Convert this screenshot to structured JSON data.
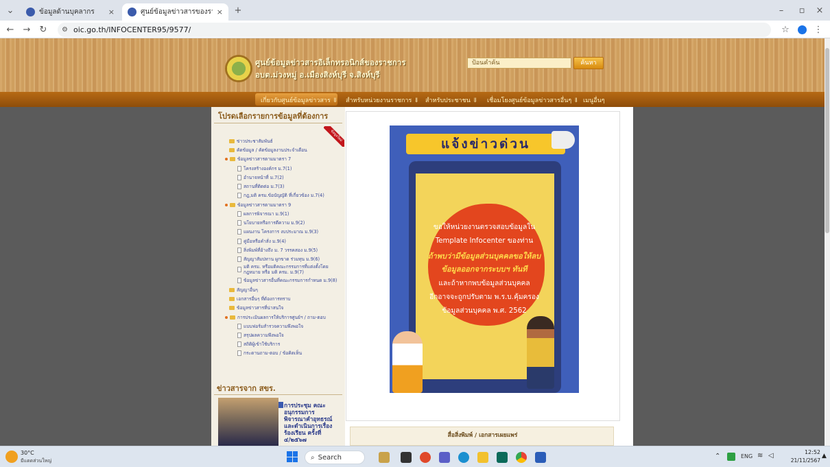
{
  "browser": {
    "tabs": [
      {
        "title": "ข้อมูลด้านบุคลากร"
      },
      {
        "title": "ศูนย์ข้อมูลข่าวสารของราชการ » อบ"
      }
    ],
    "new_tab_label": "+",
    "url": "oic.go.th/INFOCENTER95/9577/"
  },
  "site": {
    "title_line1": "ศูนย์ข้อมูลข่าวสารอิเล็กทรอนิกส์ของราชการ",
    "title_line2": "อบต.ม่วงหมู่ อ.เมืองสิงห์บุรี จ.สิงห์บุรี",
    "search_placeholder": "ป้อนคำค้น",
    "search_button": "ค้นหา",
    "nav": [
      "เกี่ยวกับศูนย์ข้อมูลข่าวสาร ⇓",
      "สำหรับหน่วยงานราชการ ⇓",
      "สำหรับประชาชน ⇓",
      "เชื่อมโยงศูนย์ข้อมูลข่าวสารอื่นๆ ⇓",
      "เมนูอื่นๆ"
    ]
  },
  "sidebar": {
    "title": "โปรดเลือกรายการข้อมูลที่ต้องการ",
    "ribbon": "ข้อมูลใหม่",
    "items": [
      {
        "label": "ข่าวประชาสัมพันธ์",
        "level": 0
      },
      {
        "label": "คัดข้อมูล / คัดข้อมูลงานประจำเดือน",
        "level": 0
      },
      {
        "label": "ข้อมูลข่าวสารตามมาตรา 7",
        "level": 0
      },
      {
        "label": "โครงสร้างองค์กร ม.7(1)",
        "level": 1
      },
      {
        "label": "อำนาจหน้าที่ ม.7(2)",
        "level": 1
      },
      {
        "label": "สถานที่ติดต่อ ม.7(3)",
        "level": 1
      },
      {
        "label": "กฎ,มติ ครม.ข้อบัญญัติ ที่เกี่ยวข้อง ม.7(4)",
        "level": 1
      },
      {
        "label": "ข้อมูลข่าวสารตามมาตรา 9",
        "level": 0
      },
      {
        "label": "ผลการพิจารณา ม.9(1)",
        "level": 1
      },
      {
        "label": "นโยบายหรือการตีความ ม.9(2)",
        "level": 1
      },
      {
        "label": "แผนงาน โครงการ งบประมาณ ม.9(3)",
        "level": 1
      },
      {
        "label": "คู่มือหรือคำสั่ง ม.9(4)",
        "level": 1
      },
      {
        "label": "สิ่งพิมพ์ที่อ้างถึง ม. 7 วรรคสอง ม.9(5)",
        "level": 1
      },
      {
        "label": "สัญญาสัมปทาน ผูกขาด ร่วมทุน ม.9(6)",
        "level": 1
      },
      {
        "label": "มติ ครม. หรือมติคณะกรรมการที่แต่งตั้งโดยกฎหมาย หรือ มติ ครม. ม.9(7)",
        "level": 1
      },
      {
        "label": "ข้อมูลข่าวสารอื่นที่คณะกรรมการกำหนด ม.9(8)",
        "level": 1
      },
      {
        "label": "สัญญาอื่นๆ",
        "level": 0
      },
      {
        "label": "เอกสารอื่นๆ ที่ต้องการทราบ",
        "level": 0
      },
      {
        "label": "ข้อมูลข่าวสารที่น่าสนใจ",
        "level": 0
      },
      {
        "label": "การประเมินผลการให้บริการศูนย์ฯ / ถาม-ตอบ",
        "level": 0
      },
      {
        "label": "แบบฟอร์มสำรวจความพึงพอใจ",
        "level": 1
      },
      {
        "label": "สรุปผลความพึงพอใจ",
        "level": 1
      },
      {
        "label": "สถิติผู้เข้าใช้บริการ",
        "level": 1
      },
      {
        "label": "กระดานถาม-ตอบ / ข้อคิดเห็น",
        "level": 1
      }
    ],
    "news_title": "ข่าวสารจาก สขร.",
    "news_text": "การประชุม คณะอนุกรรมการพิจารณาคำอุทธรณ์และดำเนินการเรื่องร้องเรียน ครั้งที่ ๔/๒๕๖๗"
  },
  "poster": {
    "banner": "แจ้งข่าวด่วน",
    "lines": [
      {
        "text": "ขอให้หน่วยงานตรวจสอบข้อมูลใน",
        "hl": false
      },
      {
        "text": "Template Infocenter ของท่าน",
        "hl": false
      },
      {
        "text": "ถ้าพบว่ามีข้อมูลส่วนบุคคลขอให้ลบ",
        "hl": true
      },
      {
        "text": "ข้อมูลออกจากระบบฯ ทันที",
        "hl": true
      },
      {
        "text": "และถ้าหากพบข้อมูลส่วนบุคคล",
        "hl": false
      },
      {
        "text": "อีกอาจจะถูกปรับตาม พ.ร.บ.คุ้มครอง",
        "hl": false
      },
      {
        "text": "ข้อมูลส่วนบุคคล พ.ศ. 2562",
        "hl": false
      }
    ]
  },
  "lower_box": {
    "title": "สื่อสิ่งพิมพ์ / เอกสารเผยแพร่"
  },
  "taskbar": {
    "weather_temp": "30°C",
    "weather_desc": "มีแดดส่วนใหญ่",
    "search_label": "Search",
    "lang": "ENG",
    "time": "12:52",
    "date": "21/11/2567"
  },
  "colors": {
    "nav_brown": "#8e4d0a",
    "poster_blue": "#3f5fba",
    "poster_orange": "#e3461e",
    "banner_yellow": "#f7c62b"
  }
}
